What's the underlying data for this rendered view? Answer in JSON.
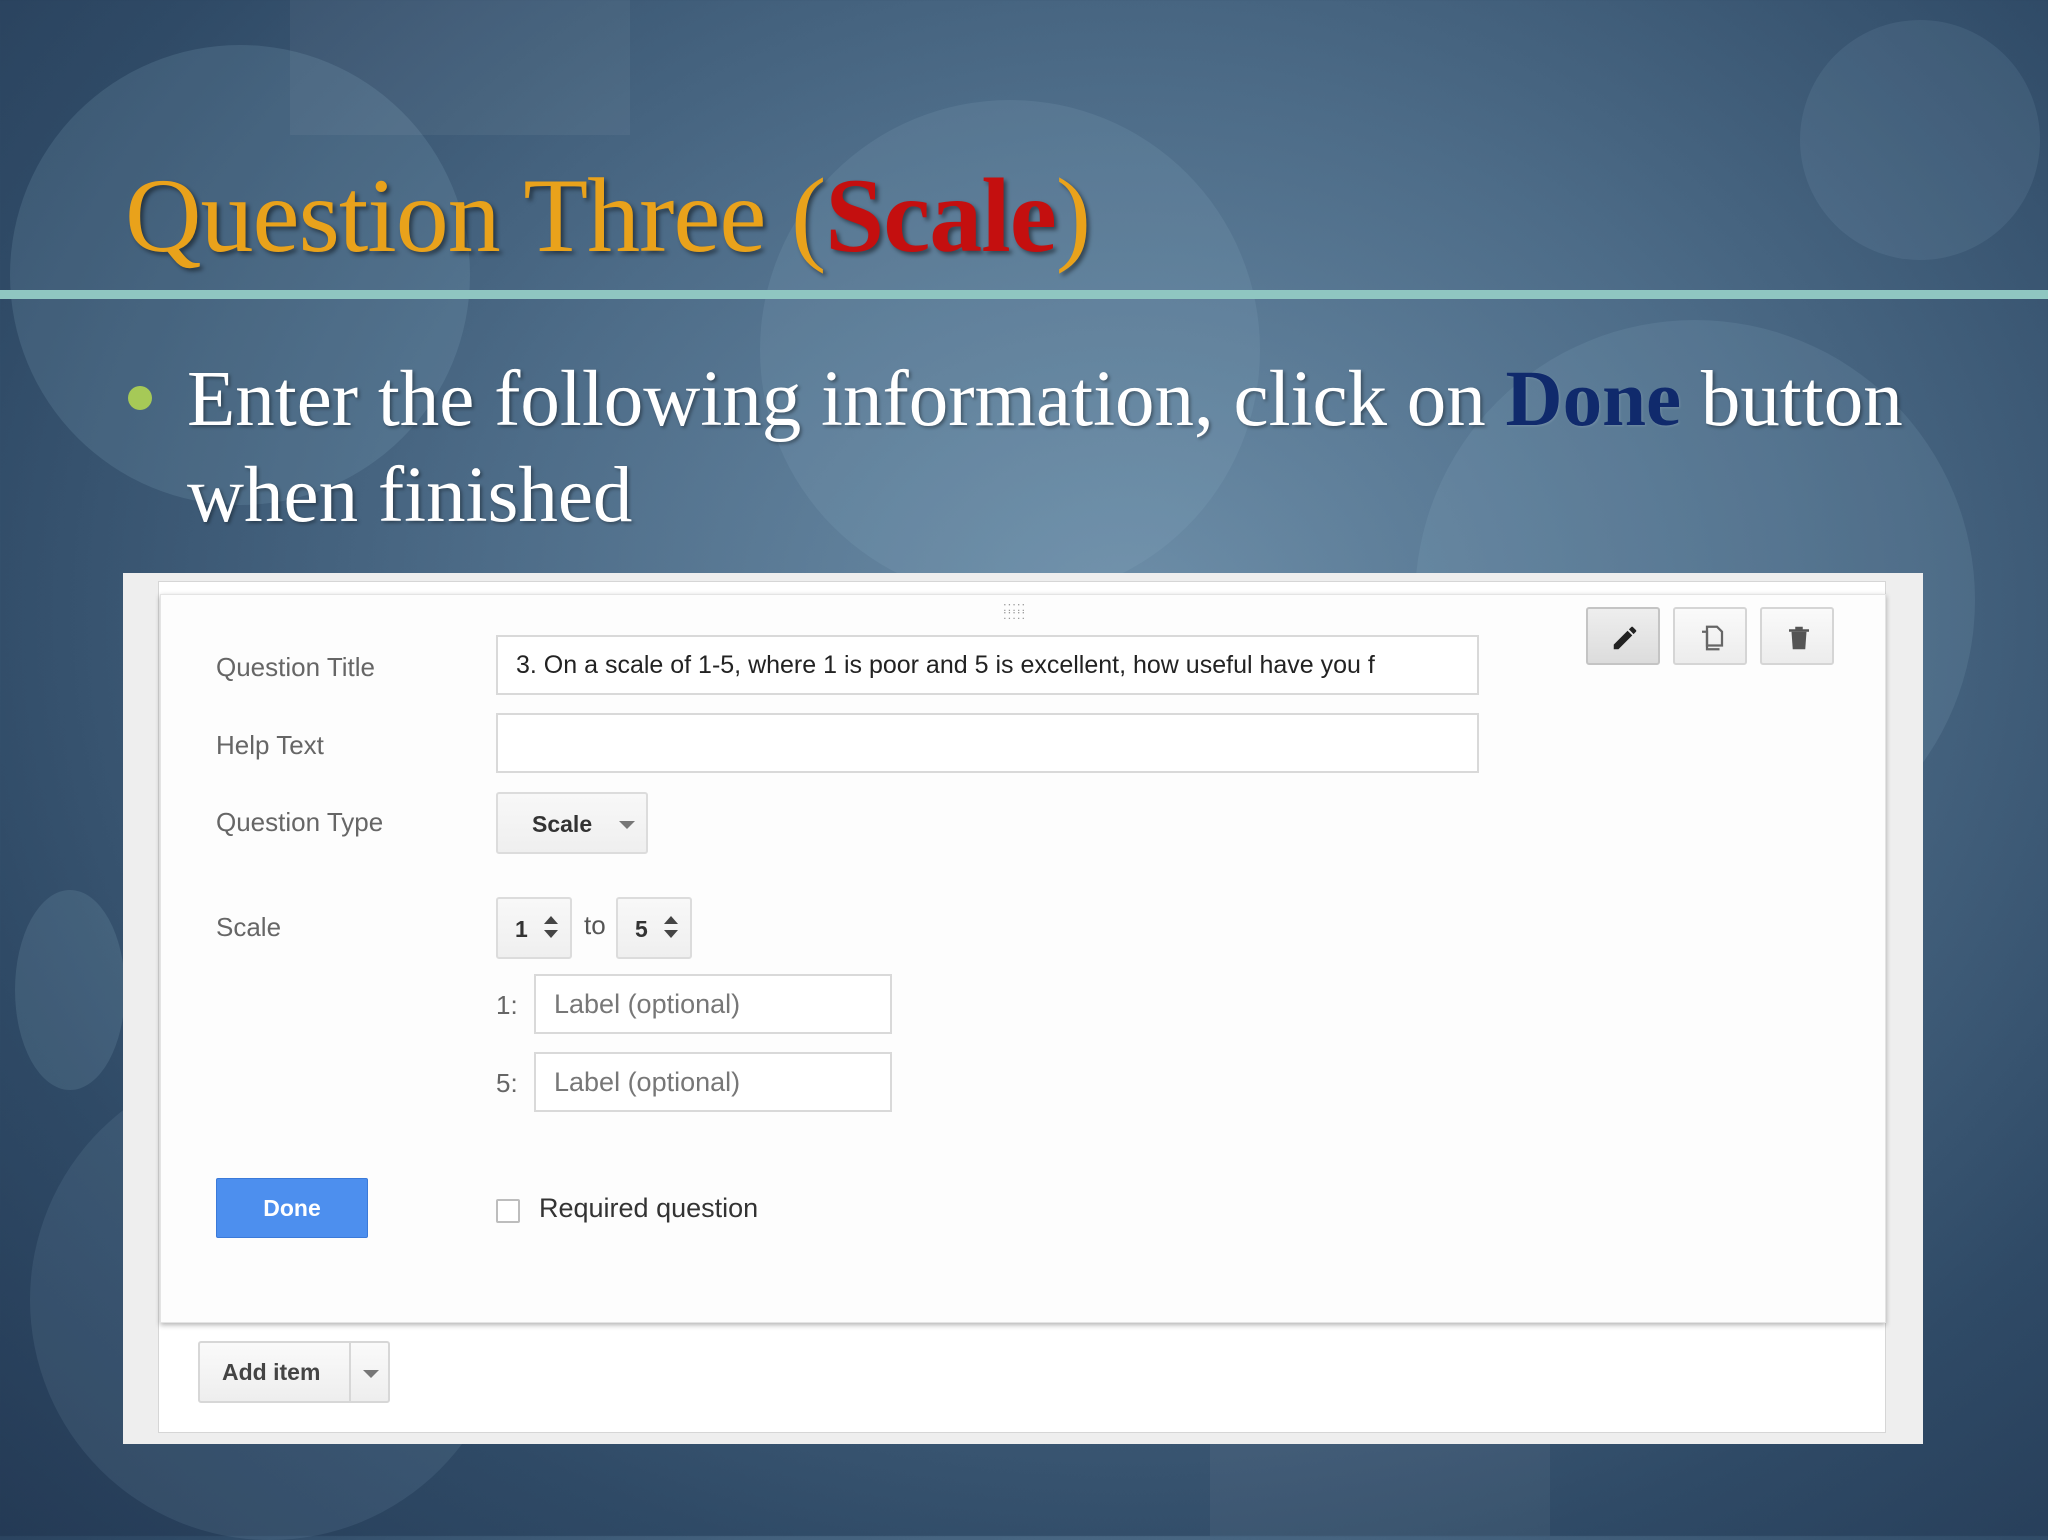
{
  "slide": {
    "title_main": "Question Three (",
    "title_accent": "Scale",
    "title_close": ")",
    "bullet_before": "Enter the following information, click on ",
    "bullet_emphasis": "Done",
    "bullet_after": " button when finished"
  },
  "form": {
    "labels": {
      "question_title": "Question Title",
      "help_text": "Help Text",
      "question_type": "Question Type",
      "scale": "Scale"
    },
    "question_title_value": "3. On a scale of 1-5, where 1 is poor and 5 is excellent, how useful have you f",
    "help_text_value": "",
    "question_type_value": "Scale",
    "scale_from": "1",
    "scale_to_word": "to",
    "scale_to": "5",
    "low_label_prefix": "1:",
    "high_label_prefix": "5:",
    "label_placeholder": "Label (optional)",
    "done_label": "Done",
    "required_label": "Required question",
    "add_item_label": "Add item"
  },
  "icons": {
    "edit": "pencil-icon",
    "duplicate": "duplicate-icon",
    "delete": "trash-icon",
    "drag": "drag-handle-icon"
  }
}
